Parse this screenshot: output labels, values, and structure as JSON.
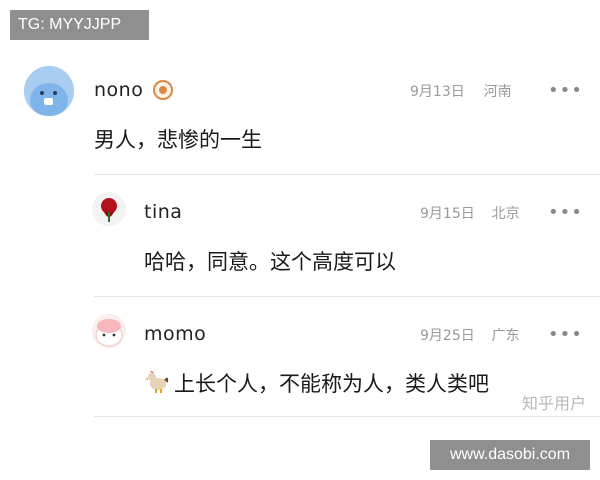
{
  "overlay": {
    "tg_label": "TG: MYYJJPP",
    "site_label": "www.dasobi.com"
  },
  "watermark": "知乎用户",
  "comments": [
    {
      "username": "nono",
      "date": "9月13日",
      "location": "河南",
      "content": "男人，悲惨的一生",
      "more": "•••"
    },
    {
      "username": "tina",
      "date": "9月15日",
      "location": "北京",
      "content": "哈哈，同意。这个高度可以",
      "more": "•••"
    },
    {
      "username": "momo",
      "date": "9月25日",
      "location": "广东",
      "content": "上长个人，不能称为人，类人类吧",
      "more": "•••"
    }
  ]
}
